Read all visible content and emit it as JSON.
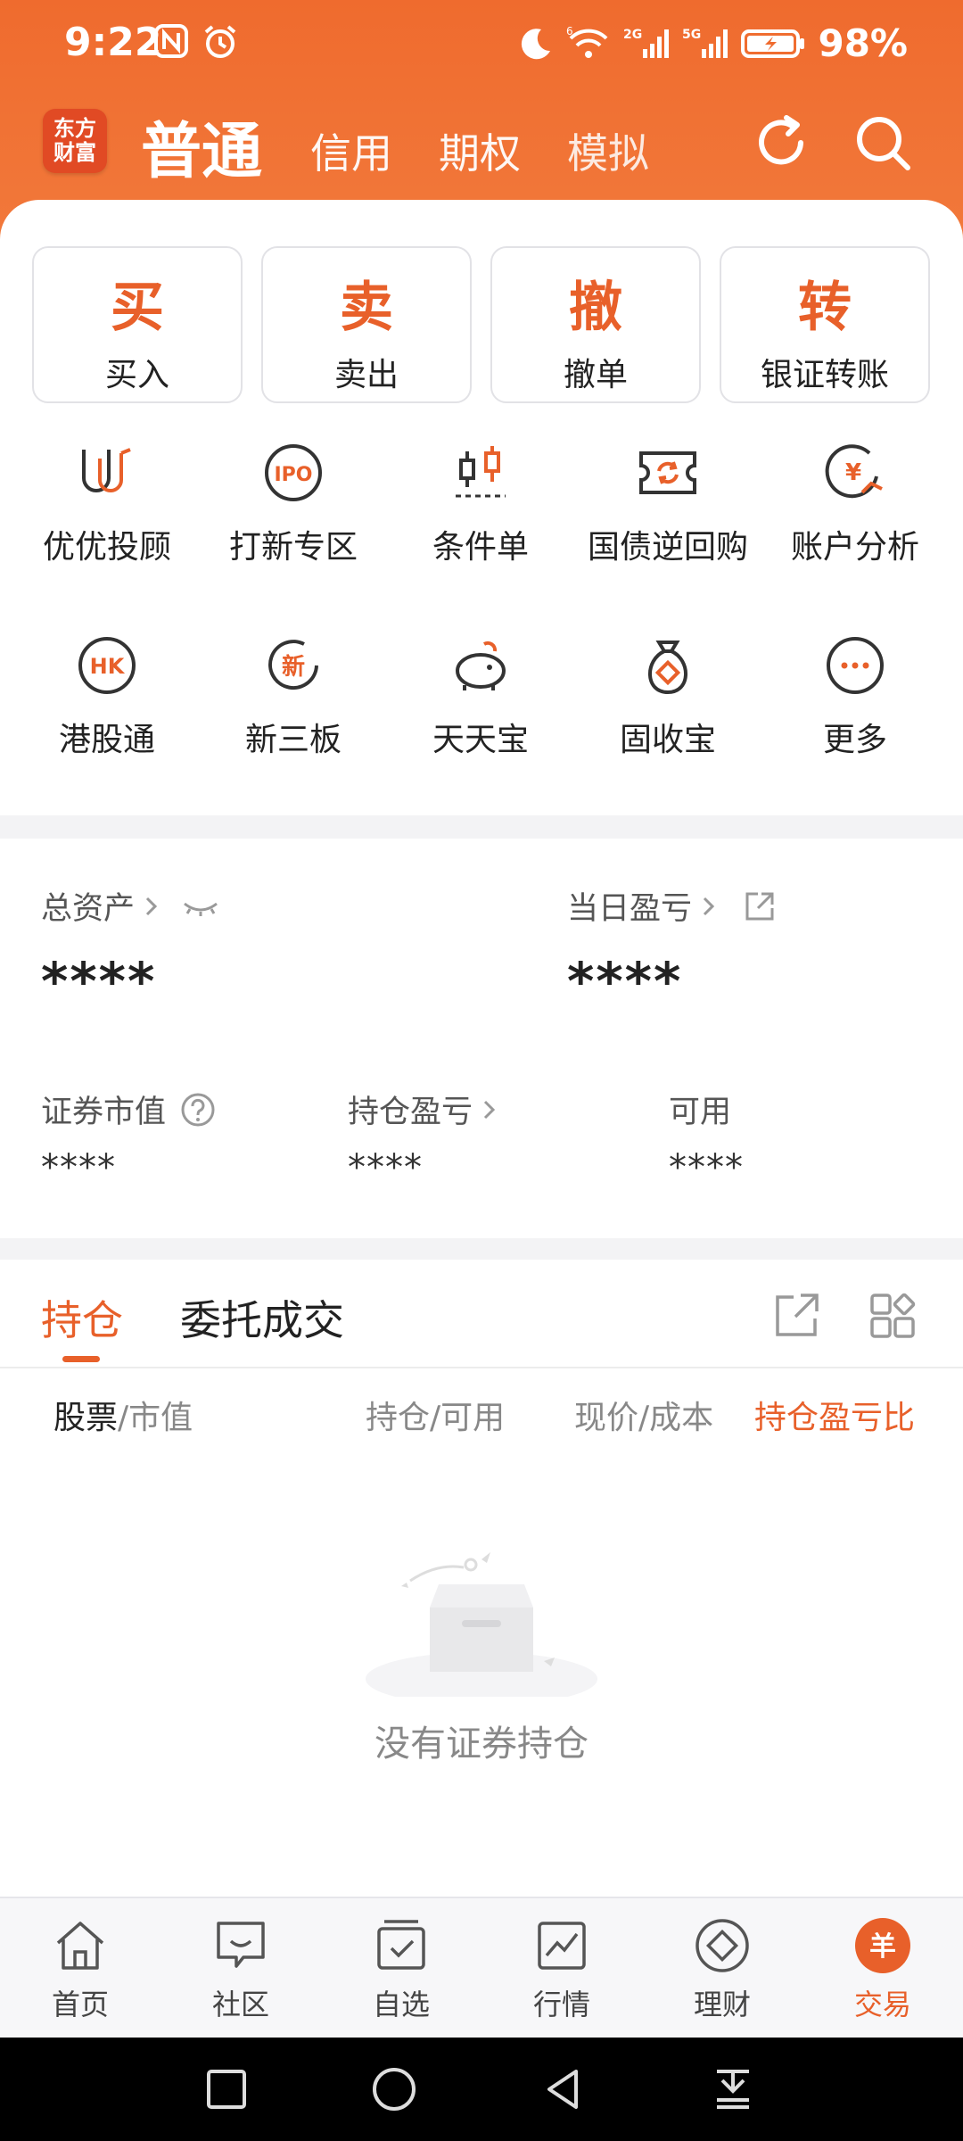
{
  "status": {
    "time": "9:22",
    "battery": "98%",
    "net_labels": [
      "6",
      "2G",
      "5G"
    ]
  },
  "header": {
    "logo_line1": "东方",
    "logo_line2": "财富",
    "account_type": "普通",
    "tabs": [
      "信用",
      "期权",
      "模拟"
    ]
  },
  "quick_actions": [
    {
      "glyph": "买",
      "label": "买入"
    },
    {
      "glyph": "卖",
      "label": "卖出"
    },
    {
      "glyph": "撤",
      "label": "撤单"
    },
    {
      "glyph": "转",
      "label": "银证转账"
    }
  ],
  "services": [
    {
      "label": "优优投顾",
      "icon": "advisor-icon"
    },
    {
      "label": "打新专区",
      "icon": "ipo-icon"
    },
    {
      "label": "条件单",
      "icon": "candlestick-icon"
    },
    {
      "label": "国债逆回购",
      "icon": "repo-icon"
    },
    {
      "label": "账户分析",
      "icon": "account-analysis-icon"
    },
    {
      "label": "港股通",
      "icon": "hk-icon"
    },
    {
      "label": "新三板",
      "icon": "new-board-icon"
    },
    {
      "label": "天天宝",
      "icon": "piggy-bank-icon"
    },
    {
      "label": "固收宝",
      "icon": "money-bag-icon"
    },
    {
      "label": "更多",
      "icon": "more-icon"
    }
  ],
  "services_extra": {
    "ipo_text": "IPO",
    "hk_text": "HK",
    "new_text": "新",
    "yen_text": "¥"
  },
  "assets": {
    "total_label": "总资产",
    "total_value": "****",
    "daily_pl_label": "当日盈亏",
    "daily_pl_value": "****",
    "market_value_label": "证券市值",
    "market_value": "****",
    "position_pl_label": "持仓盈亏",
    "position_pl_value": "****",
    "available_label": "可用",
    "available_value": "****"
  },
  "holdings": {
    "tab_active": "持仓",
    "tab_inactive": "委托成交",
    "col_stock": "股票",
    "col_stock_sub": "/市值",
    "col_position": "持仓/可用",
    "col_price": "现价/成本",
    "col_pl_ratio": "持仓盈亏比",
    "empty_text": "没有证券持仓"
  },
  "bottom_nav": [
    {
      "label": "首页",
      "icon": "home-icon"
    },
    {
      "label": "社区",
      "icon": "community-icon"
    },
    {
      "label": "自选",
      "icon": "watchlist-icon"
    },
    {
      "label": "行情",
      "icon": "market-icon"
    },
    {
      "label": "理财",
      "icon": "wealth-icon"
    },
    {
      "label": "交易",
      "icon": "trade-icon"
    }
  ],
  "bottom_nav_active": "交易",
  "trade_glyph": "羊",
  "colors": {
    "accent": "#e8602a",
    "header": "#ef6b2e",
    "logo": "#e14a24"
  }
}
